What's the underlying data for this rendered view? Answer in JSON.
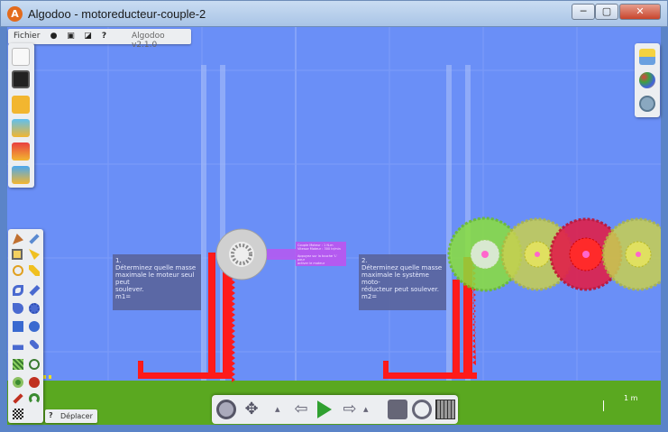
{
  "window": {
    "title": "Algodoo - motoreducteur-couple-2",
    "controls": {
      "minimize": "─",
      "maximize": "▢",
      "close": "✕"
    }
  },
  "menubar": {
    "fichier": "Fichier",
    "icons": [
      "record-icon",
      "scene-icon",
      "screen-icon",
      "help-icon"
    ],
    "help_label": "?",
    "version": "Algodoo v2.1.0"
  },
  "file_toolbar": [
    "new-file-icon",
    "save-icon",
    "open-folder-icon",
    "open-scene-icon",
    "browse-icon",
    "save-folder-icon"
  ],
  "right_toolbar": [
    "options-icon",
    "palette-icon",
    "zoom-world-icon"
  ],
  "tools": [
    "sketch-icon",
    "brush-icon",
    "move-icon",
    "drag-icon",
    "rotate-icon",
    "scale-icon",
    "rope-icon",
    "spring-icon",
    "knife-icon",
    "gear-icon",
    "box-icon",
    "circle-icon",
    "plane-icon",
    "fixate-icon",
    "chain-icon",
    "eraser-icon",
    "tracer-icon",
    "thruster-icon",
    "laser-icon",
    "hinge-icon",
    "texture-icon"
  ],
  "help": {
    "q": "?",
    "label": "Déplacer"
  },
  "playbar": [
    "zoom-icon",
    "pan-icon",
    "undo-small-icon",
    "undo-icon",
    "play-icon",
    "redo-icon",
    "redo-small-icon",
    "camera-icon",
    "follow-icon",
    "grid-icon"
  ],
  "scale": "1 m",
  "notes": {
    "note1": "1.\nDéterminez quelle masse\nmaximale le moteur seul peut\nsoulever.\nm1=",
    "note2": "2.\nDéterminez quelle masse\nmaximale le système moto-\nréducteur peut soulever.\nm2="
  },
  "purple_text": "Couple Moteur : 1 N.m\nVitesse Moteur : 300 tr/min\n\nAppuyez sur la touche 'L' pour\nactiver le moteur",
  "colors": {
    "sky": "#6a8ff7",
    "ground": "#5aa820",
    "rack": "#ff1a1a",
    "gear_green": "#8ae03c",
    "gear_yellow": "#c8d050",
    "gear_red": "#e0204a",
    "purple": "#b45af0",
    "motor_disc": "#d0d0d0"
  }
}
